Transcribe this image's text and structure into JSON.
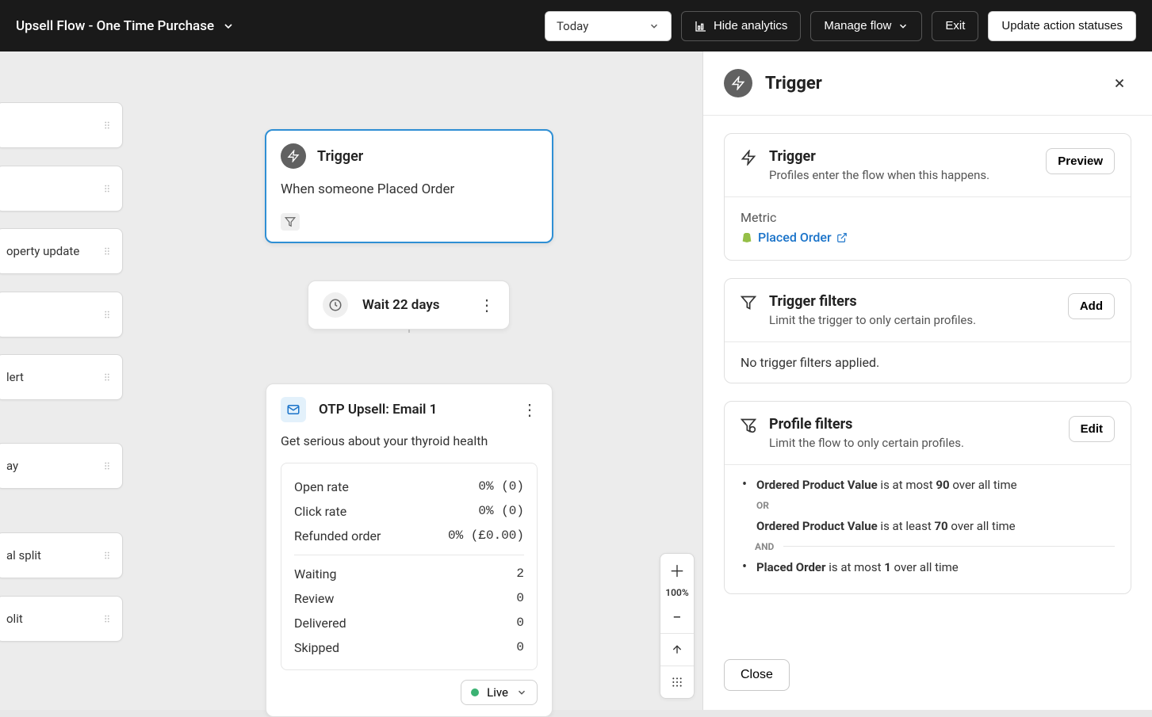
{
  "header": {
    "flow_name": "Upsell Flow - One Time Purchase",
    "date_range": "Today",
    "hide_analytics": "Hide analytics",
    "manage_flow": "Manage flow",
    "exit": "Exit",
    "update_action_statuses": "Update action statuses"
  },
  "palette": [
    {
      "label": ""
    },
    {
      "label": ""
    },
    {
      "label": "operty update"
    },
    {
      "label": ""
    },
    {
      "label": "lert"
    },
    {
      "label": "ay"
    },
    {
      "label": "al split"
    },
    {
      "label": "olit"
    }
  ],
  "palette_positions": [
    129,
    209,
    288,
    368,
    447,
    559,
    672,
    752
  ],
  "trigger_card": {
    "title": "Trigger",
    "description": "When someone Placed Order"
  },
  "wait_card": {
    "title": "Wait 22 days"
  },
  "email_card": {
    "title": "OTP Upsell: Email 1",
    "subject": "Get serious about your thyroid health",
    "metrics_top": [
      {
        "label": "Open rate",
        "value": "0% (0)"
      },
      {
        "label": "Click rate",
        "value": "0% (0)"
      },
      {
        "label": "Refunded order",
        "value": "0% (£0.00)"
      }
    ],
    "metrics_bottom": [
      {
        "label": "Waiting",
        "value": "2"
      },
      {
        "label": "Review",
        "value": "0"
      },
      {
        "label": "Delivered",
        "value": "0"
      },
      {
        "label": "Skipped",
        "value": "0"
      }
    ],
    "status": "Live"
  },
  "zoom": {
    "pct": "100%"
  },
  "panel": {
    "title": "Trigger",
    "trigger_section": {
      "title": "Trigger",
      "subtitle": "Profiles enter the flow when this happens.",
      "action": "Preview",
      "metric_label": "Metric",
      "metric_link": "Placed Order"
    },
    "trigger_filters": {
      "title": "Trigger filters",
      "subtitle": "Limit the trigger to only certain profiles.",
      "action": "Add",
      "empty": "No trigger filters applied."
    },
    "profile_filters": {
      "title": "Profile filters",
      "subtitle": "Limit the flow to only certain profiles.",
      "action": "Edit",
      "rules": {
        "r1a_field": "Ordered Product Value",
        "r1a_rest": " is at most ",
        "r1a_num": "90",
        "r1a_tail": " over all time",
        "or": "OR",
        "r1b_field": "Ordered Product Value",
        "r1b_rest": " is at least ",
        "r1b_num": "70",
        "r1b_tail": " over all time",
        "and": "AND",
        "r2_field": "Placed Order",
        "r2_rest": " is at most ",
        "r2_num": "1",
        "r2_tail": " over all time"
      }
    },
    "close": "Close"
  }
}
